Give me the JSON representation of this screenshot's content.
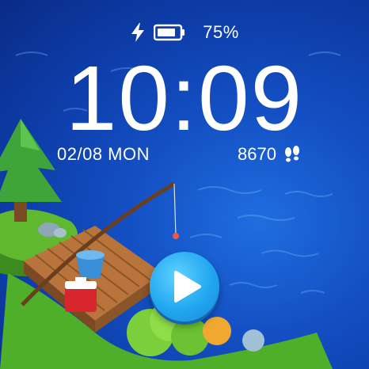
{
  "status": {
    "battery_percent": "75%",
    "battery_level": 0.75,
    "charging_icon": "lightning-bolt-icon",
    "battery_icon": "battery-icon"
  },
  "clock": {
    "time": "10:09"
  },
  "date": {
    "text": "02/08 MON"
  },
  "steps": {
    "count": "8670",
    "icon": "footsteps-icon"
  },
  "controls": {
    "play_icon": "play-icon"
  },
  "colors": {
    "water": "#1450c4",
    "play_button": "#22a7f0",
    "text": "#ffffff"
  }
}
